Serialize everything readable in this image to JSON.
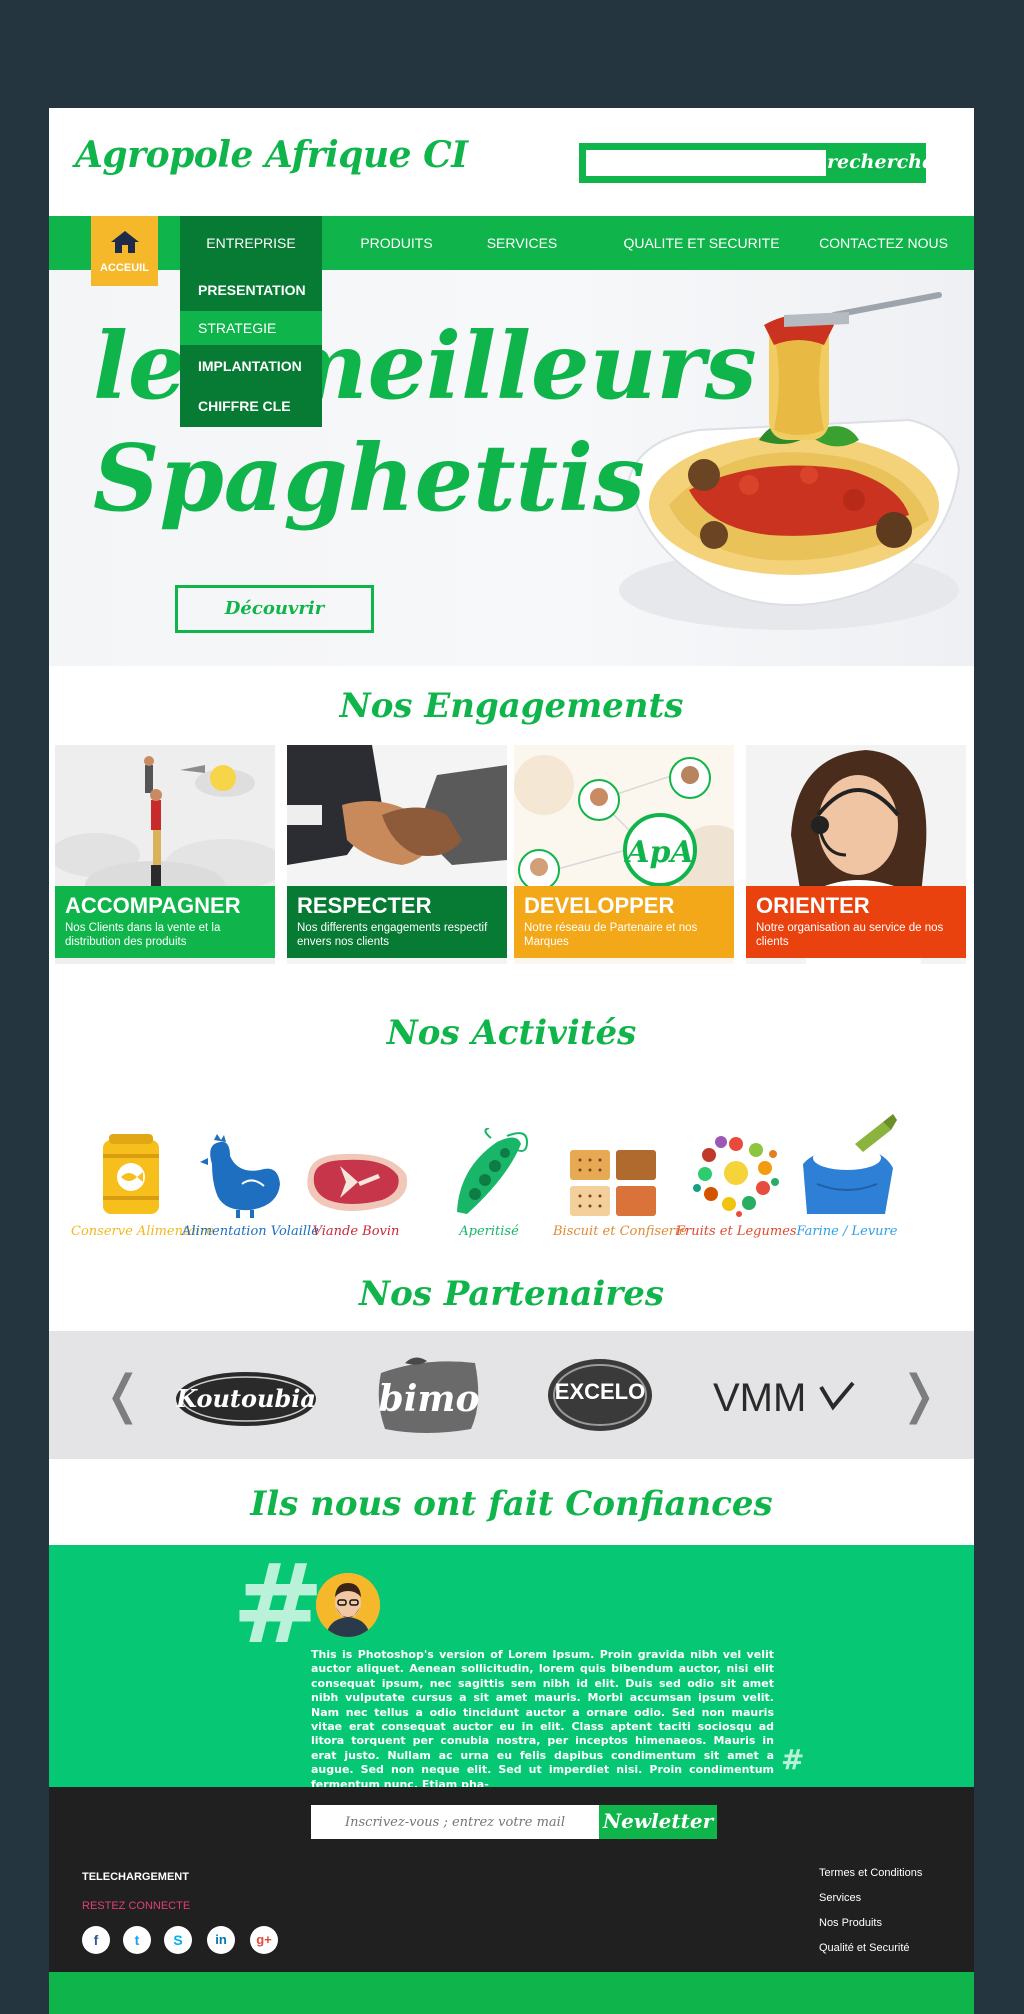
{
  "header": {
    "logo": "Agropole Afrique CI",
    "search_placeholder": "",
    "search_button": "recherche"
  },
  "nav": {
    "home_label": "ACCEUIL",
    "items": [
      "ENTREPRISE",
      "PRODUITS",
      "SERVICES",
      "QUALITE ET SECURITE",
      "CONTACTEZ NOUS"
    ],
    "dropdown": [
      "PRESENTATION",
      "STRATEGIE",
      "IMPLANTATION",
      "CHIFFRE CLE"
    ]
  },
  "hero": {
    "line1": "les meilleurs",
    "line2": "Spaghettis",
    "button": "Découvrir"
  },
  "engagements": {
    "title": "Nos Engagements",
    "cards": [
      {
        "title": "ACCOMPAGNER",
        "text": "Nos Clients dans la vente et la distribution des produits",
        "color": "#0fb54a"
      },
      {
        "title": "RESPECTER",
        "text": "Nos differents engagements respectif envers nos clients",
        "color": "#077a33"
      },
      {
        "title": "DEVELOPPER",
        "text": "Notre réseau de Partenaire et nos Marques",
        "color": "#f2a818"
      },
      {
        "title": "ORIENTER",
        "text": "Notre organisation au service de nos clients",
        "color": "#e9420f"
      }
    ],
    "badge": "ApA"
  },
  "activites": {
    "title": "Nos Activités",
    "items": [
      {
        "label": "Conserve Alimentaire",
        "color": "#f2b81f",
        "icon": "can-icon"
      },
      {
        "label": "Alimentation Volaille",
        "color": "#1e6fc0",
        "icon": "chicken-icon"
      },
      {
        "label": "Viande Bovin",
        "color": "#c8283a",
        "icon": "steak-icon"
      },
      {
        "label": "Aperitisé",
        "color": "#19b569",
        "icon": "peas-icon"
      },
      {
        "label": "Biscuit et Confiserie",
        "color": "#e08a35",
        "icon": "biscuit-icon"
      },
      {
        "label": "Fruits et Legumes",
        "color": "#e0472e",
        "icon": "fruits-icon"
      },
      {
        "label": "Farine / Levure",
        "color": "#2e9fe6",
        "icon": "flour-icon"
      }
    ]
  },
  "partenaires": {
    "title": "Nos Partenaires",
    "logos": [
      "Koutoubia",
      "bimo",
      "EXCELO",
      "VMM"
    ]
  },
  "confiance": {
    "title": "Ils nous ont fait Confiances",
    "text": "This is Photoshop's version  of Lorem Ipsum. Proin gravida nibh vel velit auctor aliquet. Aenean sollicitudin, lorem quis bibendum auctor, nisi elit consequat ipsum, nec sagittis sem nibh id elit. Duis sed odio sit amet nibh vulputate cursus a sit amet mauris. Morbi accumsan ipsum velit. Nam nec tellus a odio tincidunt auctor a ornare odio. Sed non  mauris vitae erat consequat auctor eu in elit. Class aptent taciti sociosqu ad litora torquent per conubia nostra, per inceptos himenaeos. Mauris in erat justo. Nullam ac urna eu felis dapibus condimentum sit amet a augue. Sed non neque elit. Sed ut imperdiet nisi. Proin condimentum fermentum nunc. Etiam pha-"
  },
  "footer": {
    "newsletter_placeholder": "Inscrivez-vous ; entrez votre mail",
    "newsletter_button": "Newletter",
    "telechargement": "TELECHARGEMENT",
    "restez": "RESTEZ CONNECTE",
    "socials": [
      {
        "name": "facebook-icon",
        "glyph": "f",
        "color": "#3b5998"
      },
      {
        "name": "twitter-icon",
        "glyph": "t",
        "color": "#1da1f2"
      },
      {
        "name": "skype-icon",
        "glyph": "S",
        "color": "#00aff0"
      },
      {
        "name": "linkedin-icon",
        "glyph": "in",
        "color": "#0077b5"
      },
      {
        "name": "google-plus-icon",
        "glyph": "g+",
        "color": "#dd4b39"
      }
    ],
    "links": [
      "Termes et Conditions",
      "Services",
      "Nos Produits",
      "Qualité et Securité"
    ]
  }
}
